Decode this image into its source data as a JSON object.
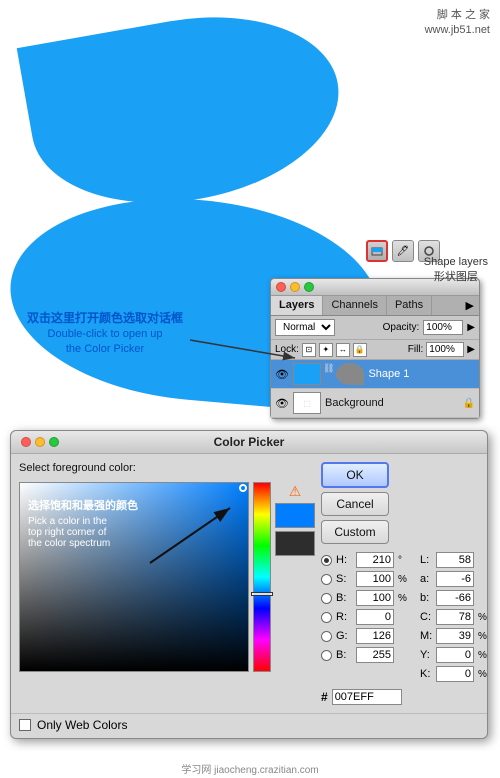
{
  "watermark": {
    "line1": "脚 本 之 家",
    "line2": "www.jb51.net"
  },
  "canvas": {
    "background": "#ffffff"
  },
  "shape_layers_hint": {
    "icon_label": "Shape layers",
    "chinese_label": "形状图层"
  },
  "annotation": {
    "chinese": "双击这里打开颜色选取对话框",
    "english1": "Double-click to open up",
    "english2": "the Color Picker"
  },
  "layers_panel": {
    "title": "",
    "tabs": [
      "Layers",
      "Channels",
      "Paths"
    ],
    "active_tab": "Layers",
    "blend_mode": "Normal",
    "opacity_label": "Opacity:",
    "opacity_value": "100%",
    "lock_label": "Lock:",
    "fill_label": "Fill:",
    "fill_value": "100%",
    "layers": [
      {
        "name": "Shape 1",
        "visible": true,
        "selected": true,
        "has_mask": true,
        "thumb_color": "#1aa0f5"
      },
      {
        "name": "Background",
        "visible": true,
        "selected": false,
        "has_mask": false,
        "thumb_color": "#ffffff",
        "locked": true
      }
    ]
  },
  "color_picker": {
    "title": "Color Picker",
    "select_label": "Select foreground color:",
    "annotation_chinese": "选择饱和和最强的颜色",
    "annotation_english1": "Pick a color in the",
    "annotation_english2": "top right corner of",
    "annotation_english3": "the color spectrum",
    "buttons": {
      "ok": "OK",
      "cancel": "Cancel",
      "custom": "Custom"
    },
    "fields": {
      "H": {
        "label": "H:",
        "value": "210",
        "unit": "°",
        "label2": "L:",
        "value2": "58"
      },
      "S": {
        "label": "S:",
        "value": "100",
        "unit": "%",
        "label2": "a:",
        "value2": "-6"
      },
      "B": {
        "label": "B:",
        "value": "100",
        "unit": "%",
        "label2": "b:",
        "value2": "-66"
      },
      "R": {
        "label": "R:",
        "value": "0",
        "unit": "",
        "label2": "C:",
        "value2": "78",
        "unit2": "%"
      },
      "G": {
        "label": "G:",
        "value": "126",
        "unit": "",
        "label2": "M:",
        "value2": "39",
        "unit2": "%"
      },
      "Bl": {
        "label": "B:",
        "value": "255",
        "unit": "",
        "label2": "Y:",
        "value2": "0",
        "unit2": "%"
      },
      "K": {
        "label": "",
        "value": "",
        "unit": "",
        "label2": "K:",
        "value2": "0",
        "unit2": "%"
      }
    },
    "hex_label": "#",
    "hex_value": "007EFF",
    "only_web_colors": "Only Web Colors"
  },
  "bottom_credit": "学习网 jiaocheng.crazitian.com"
}
